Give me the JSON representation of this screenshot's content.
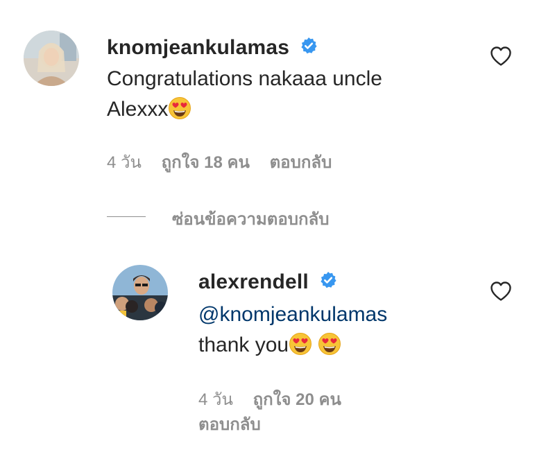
{
  "comment": {
    "username": "knomjeankulamas",
    "text_line1": "Congratulations nakaaa uncle",
    "text_line2": "Alexxx",
    "text_line2_emoji": "smiling-face-with-heart-eyes",
    "age": "4 วัน",
    "likes": "ถูกใจ 18 คน",
    "reply": "ตอบกลับ"
  },
  "hide_replies": "ซ่อนข้อความตอบกลับ",
  "reply": {
    "username": "alexrendell",
    "mention": "@knomjeankulamas",
    "text": "thank you",
    "emojis": [
      "smiling-face-with-heart-eyes",
      "smiling-face-with-heart-eyes"
    ],
    "age": "4 วัน",
    "likes": "ถูกใจ 20 คน",
    "reply": "ตอบกลับ"
  },
  "colors": {
    "text": "#262626",
    "secondary": "#8e8e8e",
    "mention": "#00376b",
    "verified": "#3897f0"
  },
  "icons": [
    "verified-badge-icon",
    "heart-icon",
    "heart-eyes-emoji"
  ]
}
